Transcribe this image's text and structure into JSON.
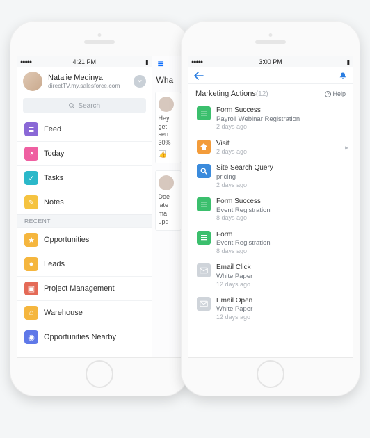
{
  "leftPhone": {
    "statusTime": "4:21 PM",
    "user": {
      "name": "Natalie Medinya",
      "domain": "directTV.my.salesforce.com"
    },
    "searchPlaceholder": "Search",
    "menu": [
      {
        "label": "Feed"
      },
      {
        "label": "Today"
      },
      {
        "label": "Tasks"
      },
      {
        "label": "Notes"
      }
    ],
    "recentHeader": "RECENT",
    "recent": [
      {
        "label": "Opportunities"
      },
      {
        "label": "Leads"
      },
      {
        "label": "Project Management"
      },
      {
        "label": "Warehouse"
      },
      {
        "label": "Opportunities Nearby"
      }
    ],
    "peekTitle": "Wha",
    "peekCard1": "Hey\nget\nsen\n30%",
    "peekCard2": "Doe\nlate\nma\nupd"
  },
  "rightPhone": {
    "statusTime": "3:00 PM",
    "sectionTitle": "Marketing Actions",
    "sectionCount": "(12)",
    "helpLabel": "Help",
    "items": [
      {
        "title": "Form Success",
        "sub": "Payroll Webinar Registration",
        "time": "2 days ago",
        "icon": "form",
        "color": "c-green",
        "caret": false
      },
      {
        "title": "Visit",
        "sub": "",
        "time": "2 days ago",
        "icon": "visit",
        "color": "c-orange",
        "caret": true
      },
      {
        "title": "Site Search Query",
        "sub": "pricing",
        "time": "2 days ago",
        "icon": "search",
        "color": "c-blue",
        "caret": false
      },
      {
        "title": "Form Success",
        "sub": "Event Registration",
        "time": "8 days ago",
        "icon": "form",
        "color": "c-green",
        "caret": false
      },
      {
        "title": "Form",
        "sub": "Event Registration",
        "time": "8 days ago",
        "icon": "form",
        "color": "c-green",
        "caret": false
      },
      {
        "title": "Email Click",
        "sub": "White Paper",
        "time": "12 days ago",
        "icon": "mail",
        "color": "c-grey",
        "caret": false
      },
      {
        "title": "Email Open",
        "sub": "White Paper",
        "time": "12 days ago",
        "icon": "mail",
        "color": "c-grey",
        "caret": false
      }
    ]
  }
}
